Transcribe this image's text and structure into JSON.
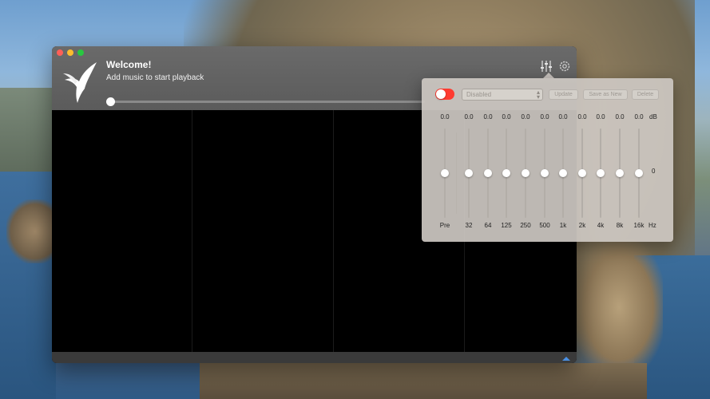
{
  "window": {
    "title": "Welcome!",
    "subtitle": "Add music to start playback",
    "seek_position": 0
  },
  "equalizer": {
    "enabled": false,
    "preset": "Disabled",
    "buttons": {
      "update": "Update",
      "save_as_new": "Save as New",
      "delete": "Delete"
    },
    "bands": [
      {
        "label": "Pre",
        "value": "0.0"
      },
      {
        "label": "32",
        "value": "0.0"
      },
      {
        "label": "64",
        "value": "0.0"
      },
      {
        "label": "125",
        "value": "0.0"
      },
      {
        "label": "250",
        "value": "0.0"
      },
      {
        "label": "500",
        "value": "0.0"
      },
      {
        "label": "1k",
        "value": "0.0"
      },
      {
        "label": "2k",
        "value": "0.0"
      },
      {
        "label": "4k",
        "value": "0.0"
      },
      {
        "label": "8k",
        "value": "0.0"
      },
      {
        "label": "16k",
        "value": "0.0"
      }
    ],
    "unit_db": "dB",
    "unit_zero": "0",
    "unit_hz": "Hz"
  },
  "colors": {
    "toggle_off": "#ff3b30",
    "accent": "#4a90e2"
  },
  "icons": {
    "equalizer": "sliders-icon",
    "settings": "gear-icon",
    "app_logo": "hummingbird-logo"
  }
}
